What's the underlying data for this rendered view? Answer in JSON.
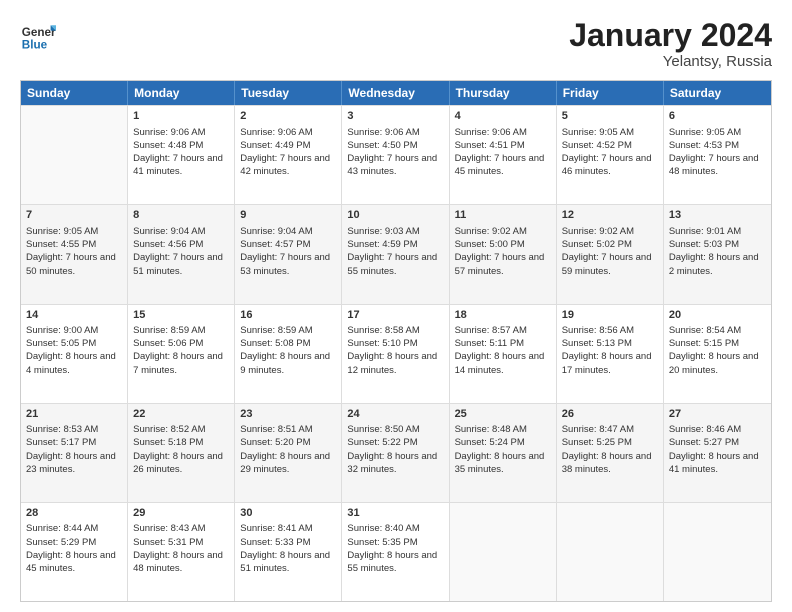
{
  "header": {
    "logo_general": "General",
    "logo_blue": "Blue",
    "title": "January 2024",
    "location": "Yelantsy, Russia"
  },
  "days_of_week": [
    "Sunday",
    "Monday",
    "Tuesday",
    "Wednesday",
    "Thursday",
    "Friday",
    "Saturday"
  ],
  "weeks": [
    [
      {
        "day": "",
        "sunrise": "",
        "sunset": "",
        "daylight": "",
        "empty": true
      },
      {
        "day": "1",
        "sunrise": "Sunrise: 9:06 AM",
        "sunset": "Sunset: 4:48 PM",
        "daylight": "Daylight: 7 hours and 41 minutes.",
        "empty": false
      },
      {
        "day": "2",
        "sunrise": "Sunrise: 9:06 AM",
        "sunset": "Sunset: 4:49 PM",
        "daylight": "Daylight: 7 hours and 42 minutes.",
        "empty": false
      },
      {
        "day": "3",
        "sunrise": "Sunrise: 9:06 AM",
        "sunset": "Sunset: 4:50 PM",
        "daylight": "Daylight: 7 hours and 43 minutes.",
        "empty": false
      },
      {
        "day": "4",
        "sunrise": "Sunrise: 9:06 AM",
        "sunset": "Sunset: 4:51 PM",
        "daylight": "Daylight: 7 hours and 45 minutes.",
        "empty": false
      },
      {
        "day": "5",
        "sunrise": "Sunrise: 9:05 AM",
        "sunset": "Sunset: 4:52 PM",
        "daylight": "Daylight: 7 hours and 46 minutes.",
        "empty": false
      },
      {
        "day": "6",
        "sunrise": "Sunrise: 9:05 AM",
        "sunset": "Sunset: 4:53 PM",
        "daylight": "Daylight: 7 hours and 48 minutes.",
        "empty": false
      }
    ],
    [
      {
        "day": "7",
        "sunrise": "Sunrise: 9:05 AM",
        "sunset": "Sunset: 4:55 PM",
        "daylight": "Daylight: 7 hours and 50 minutes.",
        "empty": false
      },
      {
        "day": "8",
        "sunrise": "Sunrise: 9:04 AM",
        "sunset": "Sunset: 4:56 PM",
        "daylight": "Daylight: 7 hours and 51 minutes.",
        "empty": false
      },
      {
        "day": "9",
        "sunrise": "Sunrise: 9:04 AM",
        "sunset": "Sunset: 4:57 PM",
        "daylight": "Daylight: 7 hours and 53 minutes.",
        "empty": false
      },
      {
        "day": "10",
        "sunrise": "Sunrise: 9:03 AM",
        "sunset": "Sunset: 4:59 PM",
        "daylight": "Daylight: 7 hours and 55 minutes.",
        "empty": false
      },
      {
        "day": "11",
        "sunrise": "Sunrise: 9:02 AM",
        "sunset": "Sunset: 5:00 PM",
        "daylight": "Daylight: 7 hours and 57 minutes.",
        "empty": false
      },
      {
        "day": "12",
        "sunrise": "Sunrise: 9:02 AM",
        "sunset": "Sunset: 5:02 PM",
        "daylight": "Daylight: 7 hours and 59 minutes.",
        "empty": false
      },
      {
        "day": "13",
        "sunrise": "Sunrise: 9:01 AM",
        "sunset": "Sunset: 5:03 PM",
        "daylight": "Daylight: 8 hours and 2 minutes.",
        "empty": false
      }
    ],
    [
      {
        "day": "14",
        "sunrise": "Sunrise: 9:00 AM",
        "sunset": "Sunset: 5:05 PM",
        "daylight": "Daylight: 8 hours and 4 minutes.",
        "empty": false
      },
      {
        "day": "15",
        "sunrise": "Sunrise: 8:59 AM",
        "sunset": "Sunset: 5:06 PM",
        "daylight": "Daylight: 8 hours and 7 minutes.",
        "empty": false
      },
      {
        "day": "16",
        "sunrise": "Sunrise: 8:59 AM",
        "sunset": "Sunset: 5:08 PM",
        "daylight": "Daylight: 8 hours and 9 minutes.",
        "empty": false
      },
      {
        "day": "17",
        "sunrise": "Sunrise: 8:58 AM",
        "sunset": "Sunset: 5:10 PM",
        "daylight": "Daylight: 8 hours and 12 minutes.",
        "empty": false
      },
      {
        "day": "18",
        "sunrise": "Sunrise: 8:57 AM",
        "sunset": "Sunset: 5:11 PM",
        "daylight": "Daylight: 8 hours and 14 minutes.",
        "empty": false
      },
      {
        "day": "19",
        "sunrise": "Sunrise: 8:56 AM",
        "sunset": "Sunset: 5:13 PM",
        "daylight": "Daylight: 8 hours and 17 minutes.",
        "empty": false
      },
      {
        "day": "20",
        "sunrise": "Sunrise: 8:54 AM",
        "sunset": "Sunset: 5:15 PM",
        "daylight": "Daylight: 8 hours and 20 minutes.",
        "empty": false
      }
    ],
    [
      {
        "day": "21",
        "sunrise": "Sunrise: 8:53 AM",
        "sunset": "Sunset: 5:17 PM",
        "daylight": "Daylight: 8 hours and 23 minutes.",
        "empty": false
      },
      {
        "day": "22",
        "sunrise": "Sunrise: 8:52 AM",
        "sunset": "Sunset: 5:18 PM",
        "daylight": "Daylight: 8 hours and 26 minutes.",
        "empty": false
      },
      {
        "day": "23",
        "sunrise": "Sunrise: 8:51 AM",
        "sunset": "Sunset: 5:20 PM",
        "daylight": "Daylight: 8 hours and 29 minutes.",
        "empty": false
      },
      {
        "day": "24",
        "sunrise": "Sunrise: 8:50 AM",
        "sunset": "Sunset: 5:22 PM",
        "daylight": "Daylight: 8 hours and 32 minutes.",
        "empty": false
      },
      {
        "day": "25",
        "sunrise": "Sunrise: 8:48 AM",
        "sunset": "Sunset: 5:24 PM",
        "daylight": "Daylight: 8 hours and 35 minutes.",
        "empty": false
      },
      {
        "day": "26",
        "sunrise": "Sunrise: 8:47 AM",
        "sunset": "Sunset: 5:25 PM",
        "daylight": "Daylight: 8 hours and 38 minutes.",
        "empty": false
      },
      {
        "day": "27",
        "sunrise": "Sunrise: 8:46 AM",
        "sunset": "Sunset: 5:27 PM",
        "daylight": "Daylight: 8 hours and 41 minutes.",
        "empty": false
      }
    ],
    [
      {
        "day": "28",
        "sunrise": "Sunrise: 8:44 AM",
        "sunset": "Sunset: 5:29 PM",
        "daylight": "Daylight: 8 hours and 45 minutes.",
        "empty": false
      },
      {
        "day": "29",
        "sunrise": "Sunrise: 8:43 AM",
        "sunset": "Sunset: 5:31 PM",
        "daylight": "Daylight: 8 hours and 48 minutes.",
        "empty": false
      },
      {
        "day": "30",
        "sunrise": "Sunrise: 8:41 AM",
        "sunset": "Sunset: 5:33 PM",
        "daylight": "Daylight: 8 hours and 51 minutes.",
        "empty": false
      },
      {
        "day": "31",
        "sunrise": "Sunrise: 8:40 AM",
        "sunset": "Sunset: 5:35 PM",
        "daylight": "Daylight: 8 hours and 55 minutes.",
        "empty": false
      },
      {
        "day": "",
        "sunrise": "",
        "sunset": "",
        "daylight": "",
        "empty": true
      },
      {
        "day": "",
        "sunrise": "",
        "sunset": "",
        "daylight": "",
        "empty": true
      },
      {
        "day": "",
        "sunrise": "",
        "sunset": "",
        "daylight": "",
        "empty": true
      }
    ]
  ]
}
